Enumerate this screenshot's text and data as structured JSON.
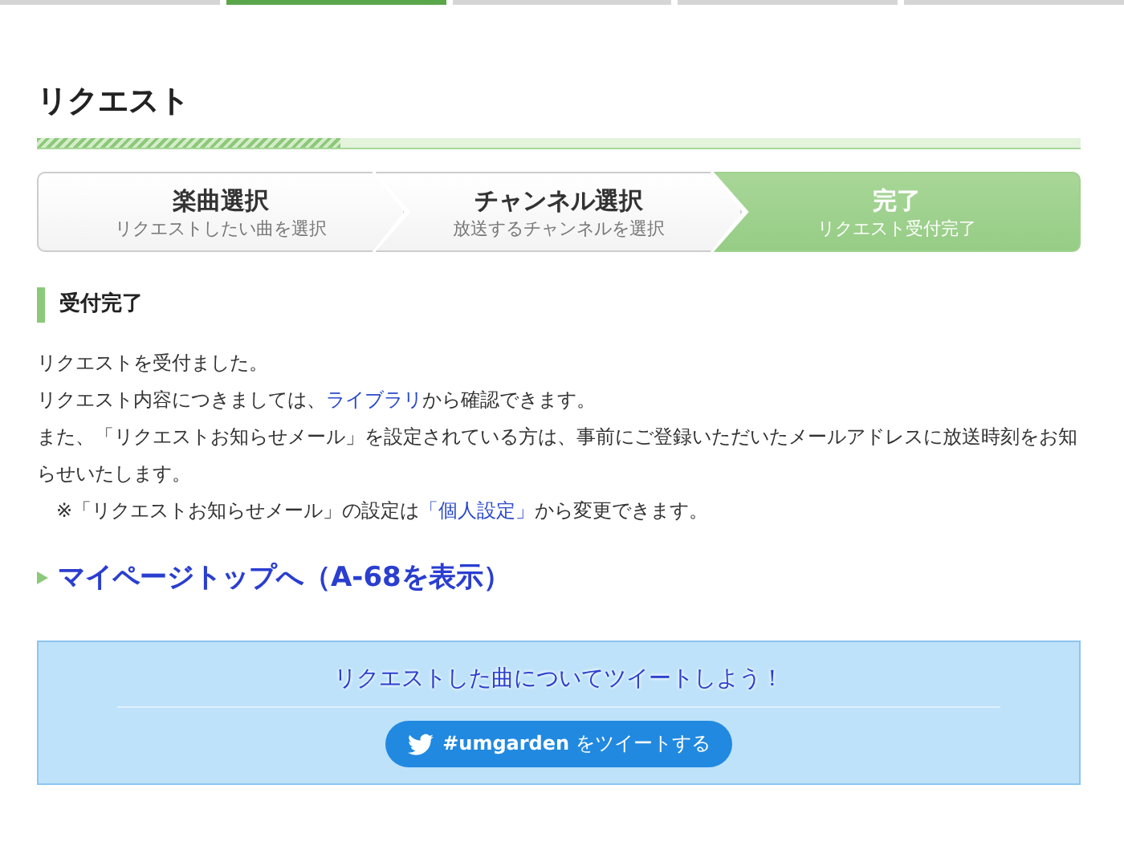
{
  "top_tabs": [
    {
      "selected": false
    },
    {
      "selected": true
    },
    {
      "selected": false
    },
    {
      "selected": false
    },
    {
      "selected": false
    }
  ],
  "page_title": "リクエスト",
  "progress": {
    "level": 0.29
  },
  "steps": [
    {
      "title": "楽曲選択",
      "subtitle": "リクエストしたい曲を選択",
      "selected": false
    },
    {
      "title": "チャンネル選択",
      "subtitle": "放送するチャンネルを選択",
      "selected": false
    },
    {
      "title": "完了",
      "subtitle": "リクエスト受付完了",
      "selected": true
    }
  ],
  "section_title": "受付完了",
  "paragraphs": [
    {
      "indent": false,
      "parts": [
        {
          "kind": "text",
          "text": "リクエストを受付ました。"
        }
      ]
    },
    {
      "indent": false,
      "parts": [
        {
          "kind": "text",
          "text": "リクエスト内容につきましては、"
        },
        {
          "kind": "link",
          "text": "ライブラリ"
        },
        {
          "kind": "text",
          "text": "から確認できます。"
        }
      ]
    },
    {
      "indent": false,
      "parts": [
        {
          "kind": "text",
          "text": "また、「リクエストお知らせメール」を設定されている方は、事前にご登録いただいたメールアドレスに放送時刻をお知らせいたします。"
        }
      ]
    },
    {
      "indent": true,
      "parts": [
        {
          "kind": "text",
          "text": "※「リクエストお知らせメール」の設定は"
        },
        {
          "kind": "link",
          "text": "「個人設定」"
        },
        {
          "kind": "text",
          "text": "から変更できます。"
        }
      ]
    }
  ],
  "mypage_link": "マイページトップへ（A-68を表示）",
  "tweet_box": {
    "heading": "リクエストした曲についてツイートしよう！",
    "button": "**#umgarden** をツイートする"
  }
}
